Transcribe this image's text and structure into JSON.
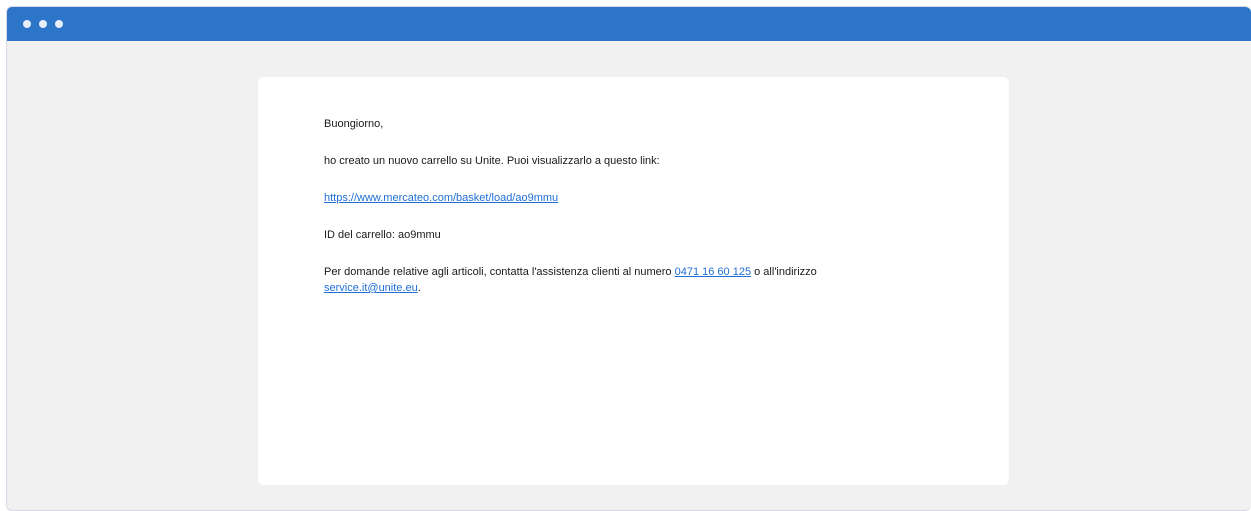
{
  "window": {
    "controls": [
      "dot",
      "dot",
      "dot"
    ]
  },
  "email": {
    "greeting": "Buongiorno,",
    "intro": "ho creato un nuovo carrello su Unite. Puoi visualizzarlo a questo link:",
    "basket_link": "https://www.mercateo.com/basket/load/ao9mmu",
    "cart_id_label": "ID del carrello: ao9mmu",
    "support_text_before": "Per domande relative agli articoli, contatta l'assistenza clienti al numero ",
    "support_phone": "0471 16 60 125",
    "support_text_middle": " o all'indirizzo ",
    "support_email": "service.it@unite.eu",
    "support_text_end": "."
  },
  "colors": {
    "titlebar": "#2c75c8",
    "link": "#1f6fd6",
    "background": "#f1f1f1"
  }
}
